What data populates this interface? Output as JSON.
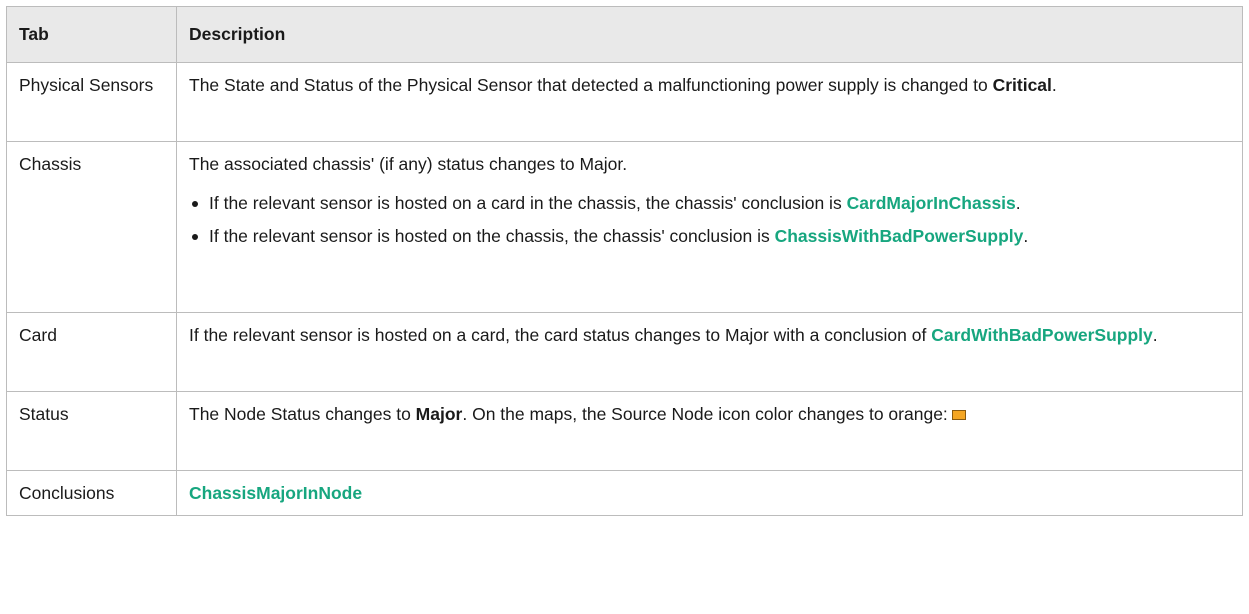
{
  "table": {
    "headers": [
      "Tab",
      "Description"
    ],
    "rows": [
      {
        "tab": "Physical Sensors",
        "desc_pre": "The State and Status of the Physical Sensor that detected a malfunctioning power supply is changed to ",
        "desc_strong": "Critical",
        "desc_post": "."
      },
      {
        "tab": "Chassis",
        "desc_intro": "The associated chassis' (if any) status changes to Major.",
        "bullets": [
          {
            "text_pre": "If the relevant sensor is hosted on a card in the chassis, the chassis' conclusion is ",
            "link": "CardMajorInChassis",
            "text_post": "."
          },
          {
            "text_pre": "If the relevant sensor is hosted on the chassis, the chassis' conclusion is ",
            "link": "ChassisWithBadPowerSupply",
            "text_post": "."
          }
        ]
      },
      {
        "tab": "Card",
        "desc_pre": "If the relevant sensor is hosted on a card, the card status changes to Major with a conclusion of ",
        "link": "CardWithBadPowerSupply",
        "desc_post": "."
      },
      {
        "tab": "Status",
        "desc_pre": "The Node Status changes to ",
        "desc_strong": "Major",
        "desc_mid": ". On the maps, the Source Node icon color changes to orange:",
        "icon": "orange-status-swatch-icon",
        "icon_color": "#f5a623"
      },
      {
        "tab": "Conclusions",
        "link": "ChassisMajorInNode"
      }
    ]
  }
}
